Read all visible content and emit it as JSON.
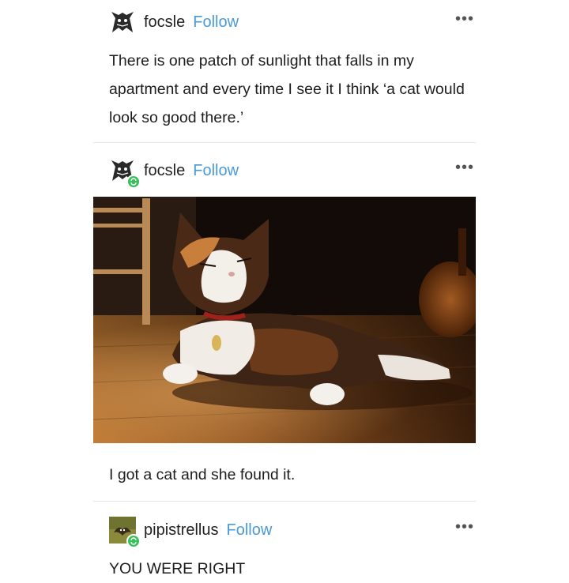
{
  "posts": [
    {
      "username": "focsle",
      "follow_label": "Follow",
      "more_label": "•••",
      "avatar_icon": "fox-avatar-icon",
      "text": "There is one patch of sunlight that falls in my apartment and every time I see it I think ‘a cat would look so good there.’"
    },
    {
      "username": "focsle",
      "follow_label": "Follow",
      "more_label": "•••",
      "avatar_icon": "fox-avatar-icon",
      "reblog_icon": "reblog-icon",
      "image_description": "calico-cat-in-sunlight-photo",
      "text": "I got a cat and she found it."
    },
    {
      "username": "pipistrellus",
      "follow_label": "Follow",
      "more_label": "•••",
      "avatar_icon": "bat-avatar-icon",
      "reblog_icon": "reblog-icon",
      "text": "YOU WERE RIGHT"
    }
  ],
  "colors": {
    "follow": "#4a9ad8",
    "reblog_badge": "#3bbf5c",
    "divider": "#e6e6e6"
  }
}
